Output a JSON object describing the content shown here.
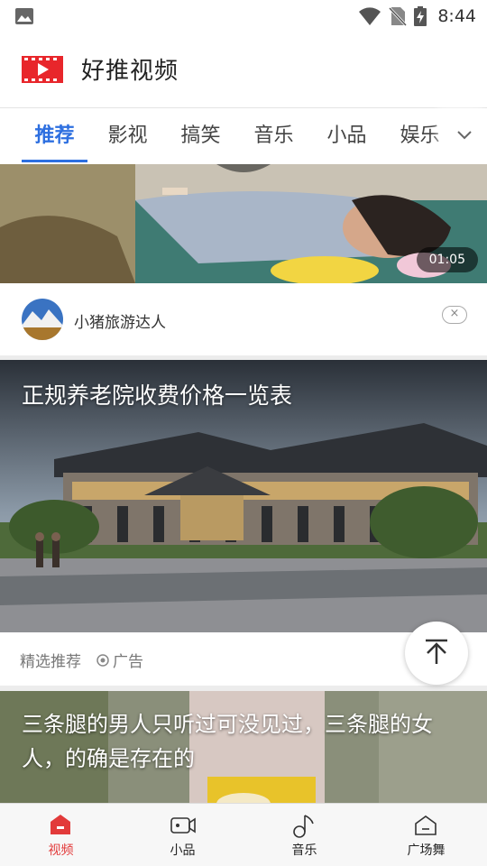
{
  "status_bar": {
    "time": "8:44"
  },
  "header": {
    "title": "好推视频"
  },
  "tabs": [
    {
      "label": "推荐"
    },
    {
      "label": "影视"
    },
    {
      "label": "搞笑"
    },
    {
      "label": "音乐"
    },
    {
      "label": "小品"
    },
    {
      "label": "娱乐"
    }
  ],
  "feed": {
    "video1": {
      "duration": "01:05",
      "author": "小猪旅游达人",
      "dismiss": "×"
    },
    "ad": {
      "title": "正规养老院收费价格一览表",
      "source": "精选推荐",
      "label": "广告",
      "dismiss": "×"
    },
    "video2": {
      "title": "三条腿的男人只听过可没见过，三条腿的女人，的确是存在的"
    }
  },
  "bottom_nav": [
    {
      "label": "视频",
      "icon": "home-icon"
    },
    {
      "label": "小品",
      "icon": "video-camera-icon"
    },
    {
      "label": "音乐",
      "icon": "music-note-icon"
    },
    {
      "label": "广场舞",
      "icon": "square-dance-icon"
    }
  ],
  "colors": {
    "accent": "#2d6fe0",
    "nav_active": "#e23a3a"
  }
}
